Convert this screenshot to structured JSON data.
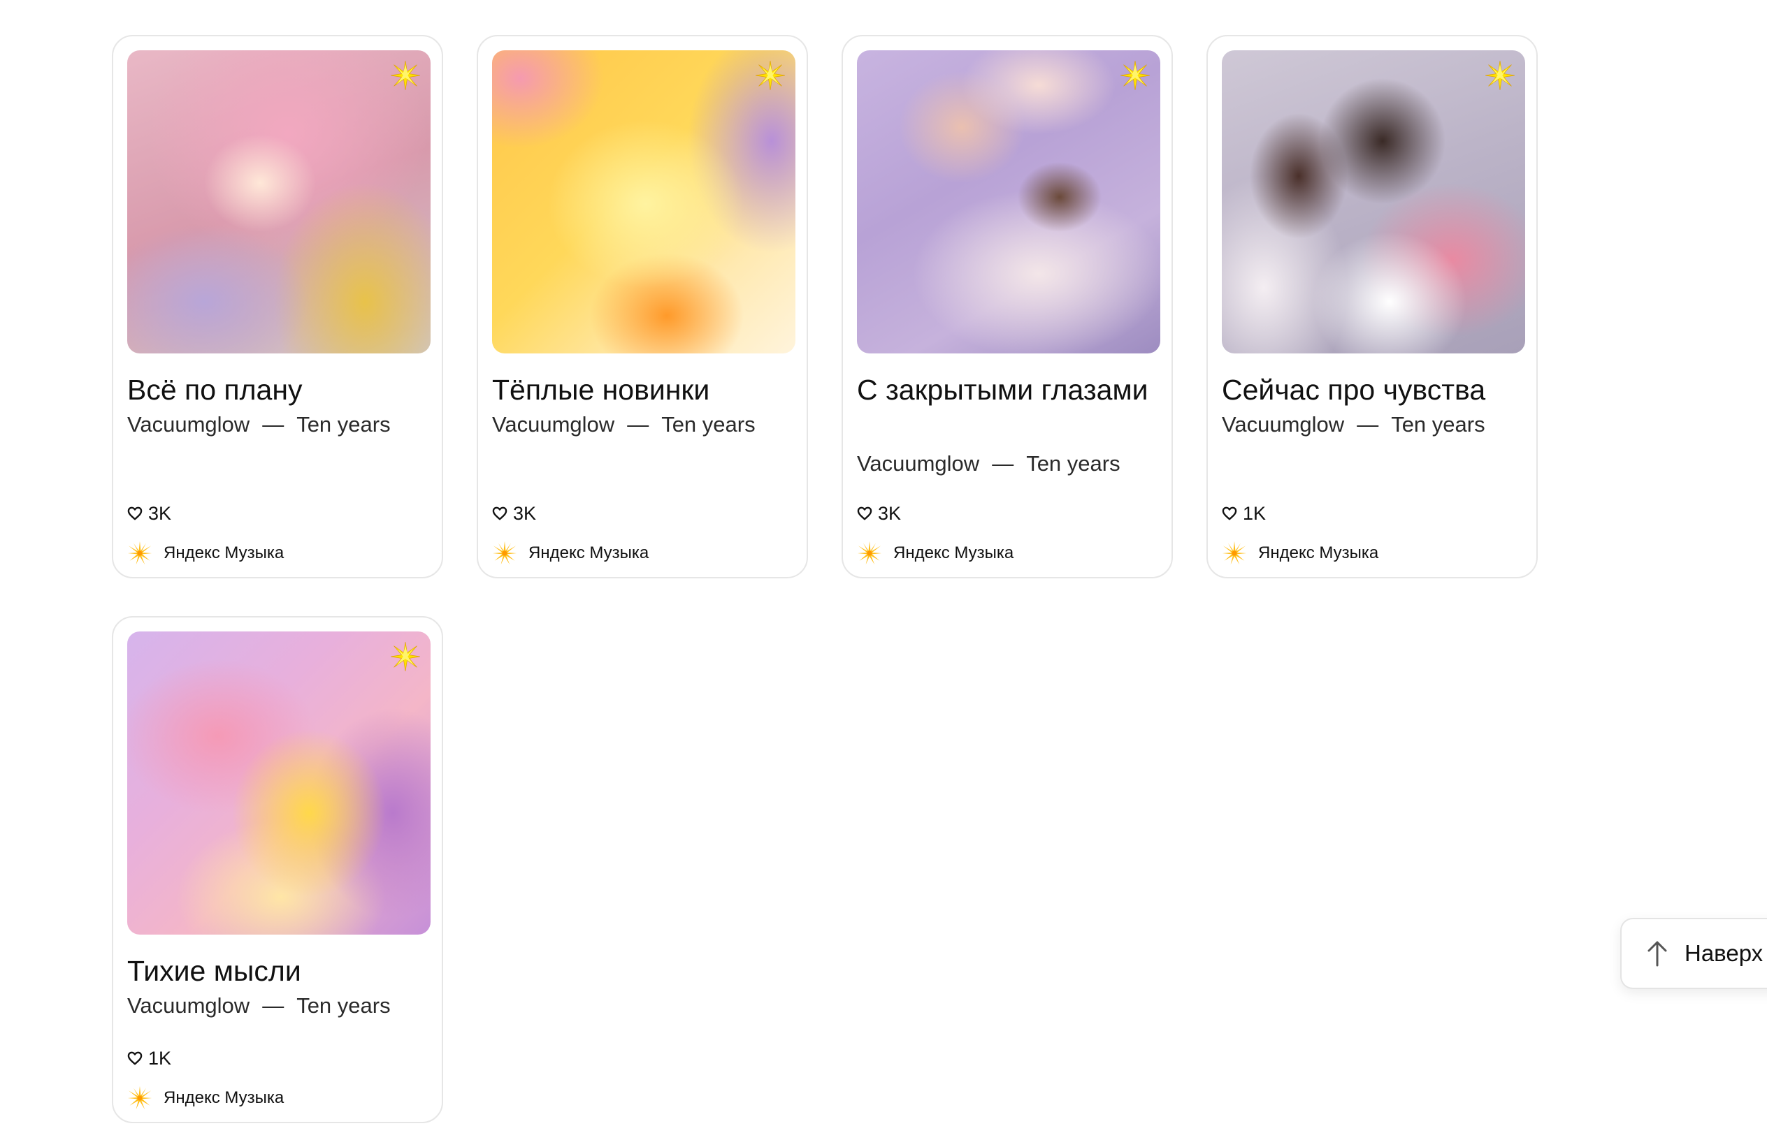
{
  "playlists": [
    {
      "title": "Всё по плану",
      "artist": "Vacuumglow",
      "separator": "—",
      "album": "Ten years",
      "likes": "3K",
      "source": "Яндекс Музыка",
      "cover": "pink-sweater-laptop-photo"
    },
    {
      "title": "Тёплые новинки",
      "artist": "Vacuumglow",
      "separator": "—",
      "album": "Ten years",
      "likes": "3K",
      "source": "Яндекс Музыка",
      "cover": "warm-yellow-gradient-art"
    },
    {
      "title": "С закрытыми глазами",
      "artist": "Vacuumglow",
      "separator": "—",
      "album": "Ten years",
      "likes": "3K",
      "source": "Яндекс Музыка",
      "cover": "sleeping-woman-eye-mask-photo"
    },
    {
      "title": "Сейчас про чувства",
      "artist": "Vacuumglow",
      "separator": "—",
      "album": "Ten years",
      "likes": "1K",
      "source": "Яндекс Музыка",
      "cover": "embracing-couple-photo"
    },
    {
      "title": "Тихие мысли",
      "artist": "Vacuumglow",
      "separator": "—",
      "album": "Ten years",
      "likes": "1K",
      "source": "Яндекс Музыка",
      "cover": "lilac-gradient-art"
    }
  ],
  "to_top": {
    "label": "Наверх",
    "icon": "arrow-up-icon"
  },
  "icons": {
    "like": "heart-outline-icon",
    "source": "yandex-music-star-icon",
    "cover_badge": "sparkle-badge-icon"
  },
  "colors": {
    "badge_yellow": "#ffd400",
    "border": "#e6e6e6",
    "text": "#111111"
  }
}
